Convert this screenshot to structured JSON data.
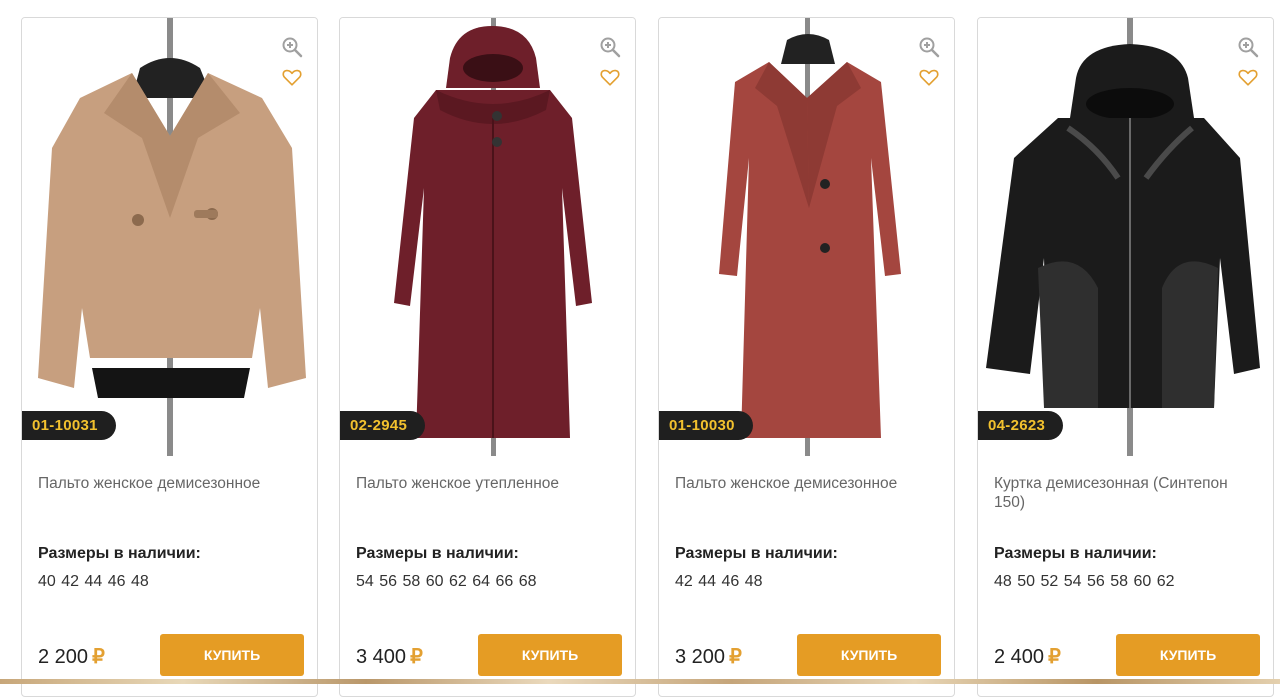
{
  "products": [
    {
      "article": "01-10031",
      "title": "Пальто женское демисезонное",
      "sizes_label": "Размеры в наличии:",
      "sizes": "40 42 44 46 48",
      "price": "2 200",
      "currency": "₽",
      "buy_label": "Купить",
      "garment_color": "#c79f7f"
    },
    {
      "article": "02-2945",
      "title": "Пальто женское утепленное",
      "sizes_label": "Размеры в наличии:",
      "sizes": "54 56 58 60 62 64 66 68",
      "price": "3 400",
      "currency": "₽",
      "buy_label": "Купить",
      "garment_color": "#6e1f2a"
    },
    {
      "article": "01-10030",
      "title": "Пальто женское демисезонное",
      "sizes_label": "Размеры в наличии:",
      "sizes": "42 44 46 48",
      "price": "3 200",
      "currency": "₽",
      "buy_label": "Купить",
      "garment_color": "#a4463f"
    },
    {
      "article": "04-2623",
      "title": "Куртка демисезонная (Синтепон 150)",
      "sizes_label": "Размеры в наличии:",
      "sizes": "48 50 52 54 56 58 60 62",
      "price": "2 400",
      "currency": "₽",
      "buy_label": "Купить",
      "garment_color": "#1b1b1b"
    }
  ],
  "colors": {
    "accent": "#e59c24",
    "article_badge_bg": "#1f1f1f",
    "article_badge_text": "#f2c12e",
    "icon_color": "#e3a031"
  },
  "icons": {
    "zoom": "zoom-in-icon",
    "favorite": "heart-icon"
  }
}
